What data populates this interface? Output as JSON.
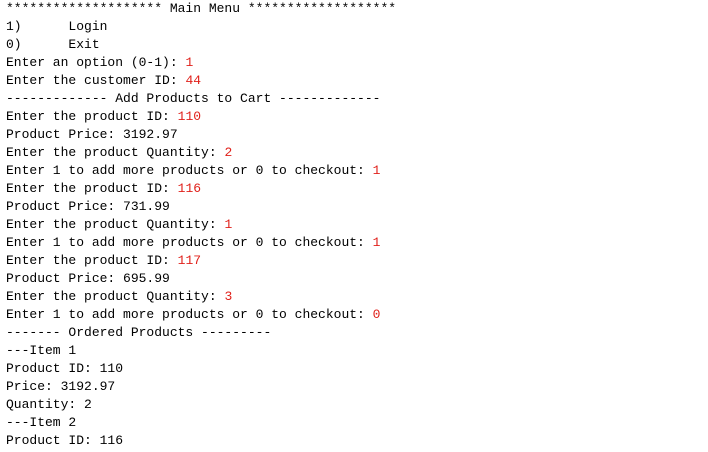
{
  "colors": {
    "background": "#ffffff",
    "output_text": "#000000",
    "user_input": "#e0201a"
  },
  "console": {
    "lines": [
      {
        "text": "******************** Main Menu *******************",
        "input": ""
      },
      {
        "text": "1)      Login",
        "input": ""
      },
      {
        "text": "0)      Exit",
        "input": ""
      },
      {
        "text": "Enter an option (0-1): ",
        "input": "1"
      },
      {
        "text": "Enter the customer ID: ",
        "input": "44"
      },
      {
        "text": "------------- Add Products to Cart -------------",
        "input": ""
      },
      {
        "text": "Enter the product ID: ",
        "input": "110"
      },
      {
        "text": "Product Price: 3192.97",
        "input": ""
      },
      {
        "text": "Enter the product Quantity: ",
        "input": "2"
      },
      {
        "text": "Enter 1 to add more products or 0 to checkout: ",
        "input": "1"
      },
      {
        "text": "Enter the product ID: ",
        "input": "116"
      },
      {
        "text": "Product Price: 731.99",
        "input": ""
      },
      {
        "text": "Enter the product Quantity: ",
        "input": "1"
      },
      {
        "text": "Enter 1 to add more products or 0 to checkout: ",
        "input": "1"
      },
      {
        "text": "Enter the product ID: ",
        "input": "117"
      },
      {
        "text": "Product Price: 695.99",
        "input": ""
      },
      {
        "text": "Enter the product Quantity: ",
        "input": "3"
      },
      {
        "text": "Enter 1 to add more products or 0 to checkout: ",
        "input": "0"
      },
      {
        "text": "------- Ordered Products ---------",
        "input": ""
      },
      {
        "text": "---Item 1",
        "input": ""
      },
      {
        "text": "Product ID: 110",
        "input": ""
      },
      {
        "text": "Price: 3192.97",
        "input": ""
      },
      {
        "text": "Quantity: 2",
        "input": ""
      },
      {
        "text": "---Item 2",
        "input": ""
      },
      {
        "text": "Product ID: 116",
        "input": ""
      }
    ]
  }
}
